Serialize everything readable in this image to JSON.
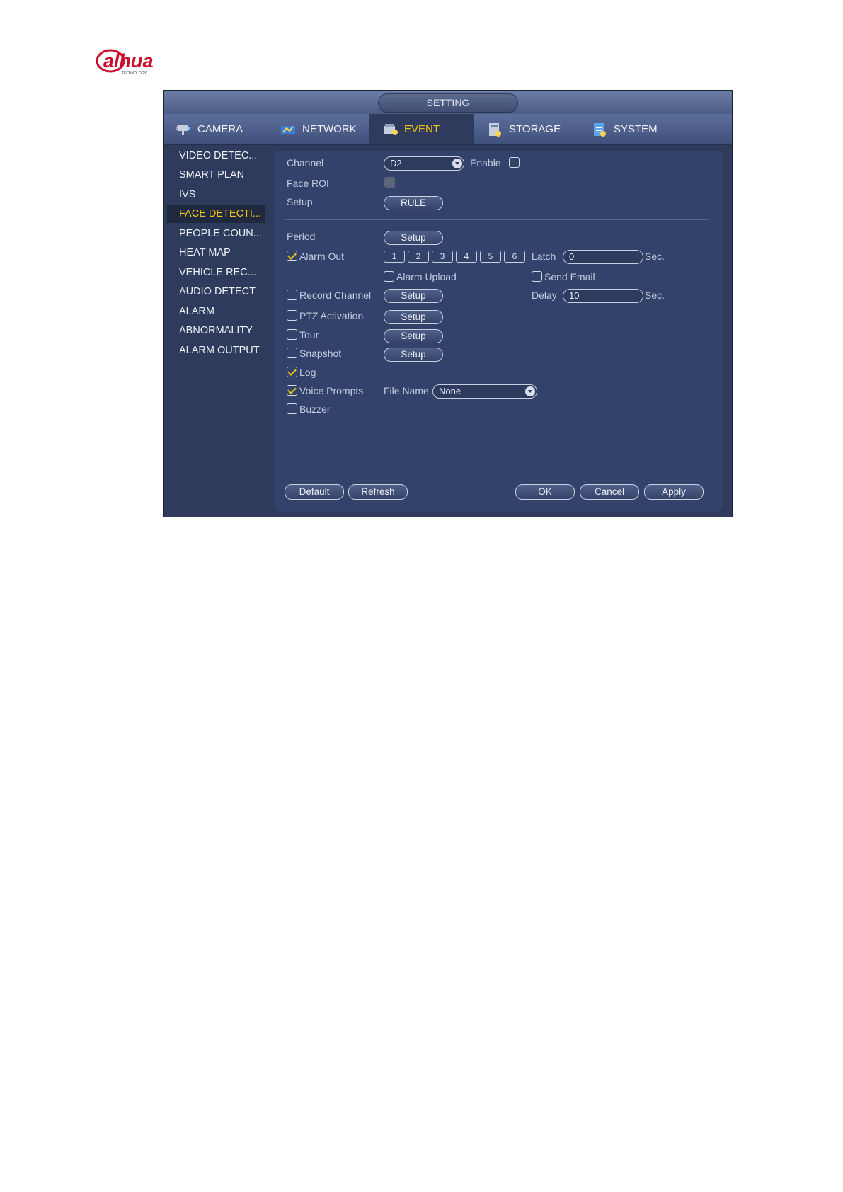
{
  "brand": {
    "logo_text": "alhua",
    "logo_sub": "TECHNOLOGY",
    "logo_color": "#c8102e"
  },
  "window": {
    "title": "SETTING"
  },
  "tabs": [
    {
      "label": "CAMERA",
      "icon": "camera-icon"
    },
    {
      "label": "NETWORK",
      "icon": "network-icon"
    },
    {
      "label": "EVENT",
      "icon": "event-icon",
      "active": true
    },
    {
      "label": "STORAGE",
      "icon": "storage-icon"
    },
    {
      "label": "SYSTEM",
      "icon": "system-icon"
    }
  ],
  "sidebar": {
    "items": [
      {
        "label": "VIDEO DETEC..."
      },
      {
        "label": "SMART PLAN"
      },
      {
        "label": "IVS"
      },
      {
        "label": "FACE DETECTI...",
        "active": true
      },
      {
        "label": "PEOPLE COUN..."
      },
      {
        "label": "HEAT MAP"
      },
      {
        "label": "VEHICLE REC..."
      },
      {
        "label": "AUDIO DETECT"
      },
      {
        "label": "ALARM"
      },
      {
        "label": "ABNORMALITY"
      },
      {
        "label": "ALARM OUTPUT"
      }
    ]
  },
  "form": {
    "channel_label": "Channel",
    "channel_value": "D2",
    "enable_label": "Enable",
    "enable_checked": false,
    "face_roi_label": "Face ROI",
    "setup_label": "Setup",
    "rule_button": "RULE",
    "period_label": "Period",
    "setup_button": "Setup",
    "alarm_out_label": "Alarm Out",
    "alarm_out_checked": true,
    "alarm_outputs": [
      "1",
      "2",
      "3",
      "4",
      "5",
      "6"
    ],
    "latch_label": "Latch",
    "latch_value": "0",
    "sec_label": "Sec.",
    "alarm_upload_label": "Alarm Upload",
    "alarm_upload_checked": false,
    "send_email_label": "Send Email",
    "send_email_checked": false,
    "record_channel_label": "Record Channel",
    "record_channel_checked": false,
    "delay_label": "Delay",
    "delay_value": "10",
    "ptz_label": "PTZ Activation",
    "ptz_checked": false,
    "tour_label": "Tour",
    "tour_checked": false,
    "snapshot_label": "Snapshot",
    "snapshot_checked": false,
    "log_label": "Log",
    "log_checked": true,
    "voice_prompts_label": "Voice Prompts",
    "voice_prompts_checked": true,
    "file_name_label": "File Name",
    "file_name_value": "None",
    "buzzer_label": "Buzzer",
    "buzzer_checked": false
  },
  "footer": {
    "default_button": "Default",
    "refresh_button": "Refresh",
    "ok_button": "OK",
    "cancel_button": "Cancel",
    "apply_button": "Apply"
  },
  "colors": {
    "accent": "#f0c419",
    "panel": "#33426a",
    "window": "#2e3b5c"
  }
}
